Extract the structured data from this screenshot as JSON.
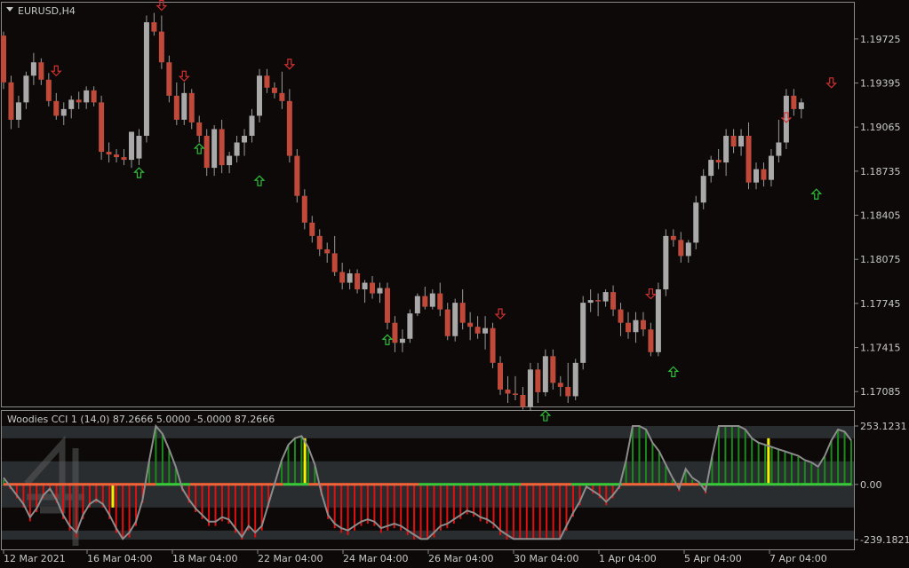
{
  "window": {
    "symbol_title": "EURUSD,H4",
    "indicator_title": "Woodies CCI 1 (14,0) 87.2666 5.0000 -5.0000 87.2666"
  },
  "colors": {
    "background": "#0c0908",
    "bull_candle": "#a9a9a9",
    "bear_candle": "#c0493a",
    "wick": "#9a9a9a",
    "up_arrow": "#2fbf3a",
    "down_arrow": "#d03030",
    "cci_line": "#8c8c8c",
    "hist_red": "#e01010",
    "hist_green": "#1a8a1a",
    "hist_yellow": "#f2f200",
    "zero_red": "#ff6030",
    "zero_green": "#30d030",
    "band": "#2a2d30",
    "axis_text": "#c8c8c8",
    "frame": "#8a8a8a"
  },
  "price_axis": {
    "labels": [
      "1.19725",
      "1.19395",
      "1.19065",
      "1.18735",
      "1.18405",
      "1.18075",
      "1.17745",
      "1.17415",
      "1.17085"
    ]
  },
  "indicator_axis": {
    "labels": [
      "253.1231",
      "0.00",
      "-239.1821"
    ]
  },
  "time_axis": {
    "labels": [
      "12 Mar 2021",
      "16 Mar 04:00",
      "18 Mar 04:00",
      "22 Mar 04:00",
      "24 Mar 04:00",
      "26 Mar 04:00",
      "30 Mar 04:00",
      "1 Apr 04:00",
      "5 Apr 04:00",
      "7 Apr 04:00"
    ]
  },
  "chart_data": [
    {
      "type": "candlestick",
      "title": "EURUSD,H4",
      "ylim": [
        1.1698,
        1.1999
      ],
      "ticks": [
        1.19725,
        1.19395,
        1.19065,
        1.18735,
        1.18405,
        1.18075,
        1.17745,
        1.17415,
        1.17085
      ],
      "bars": [
        [
          1.1975,
          1.1978,
          1.1935,
          1.194
        ],
        [
          1.194,
          1.1945,
          1.1905,
          1.1912
        ],
        [
          1.1912,
          1.193,
          1.1906,
          1.1925
        ],
        [
          1.1925,
          1.1948,
          1.192,
          1.1945
        ],
        [
          1.1945,
          1.1962,
          1.1938,
          1.1955
        ],
        [
          1.1955,
          1.1958,
          1.1938,
          1.1942
        ],
        [
          1.1942,
          1.1947,
          1.1922,
          1.1926
        ],
        [
          1.1926,
          1.1932,
          1.1912,
          1.1915
        ],
        [
          1.1915,
          1.1925,
          1.1908,
          1.192
        ],
        [
          1.192,
          1.193,
          1.1913,
          1.1927
        ],
        [
          1.1927,
          1.1933,
          1.192,
          1.1925
        ],
        [
          1.1925,
          1.1937,
          1.192,
          1.1934
        ],
        [
          1.1934,
          1.1937,
          1.1922,
          1.1925
        ],
        [
          1.1925,
          1.193,
          1.1882,
          1.1888
        ],
        [
          1.1888,
          1.1895,
          1.188,
          1.1886
        ],
        [
          1.1886,
          1.189,
          1.188,
          1.1884
        ],
        [
          1.1884,
          1.189,
          1.1878,
          1.1882
        ],
        [
          1.1882,
          1.1895,
          1.1876,
          1.1903
        ],
        [
          1.1883,
          1.1905,
          1.1878,
          1.19
        ],
        [
          1.19,
          1.199,
          1.1895,
          1.1985
        ],
        [
          1.1985,
          1.1992,
          1.1975,
          1.1978
        ],
        [
          1.1978,
          1.199,
          1.195,
          1.1955
        ],
        [
          1.1955,
          1.196,
          1.1925,
          1.193
        ],
        [
          1.193,
          1.194,
          1.1908,
          1.1912
        ],
        [
          1.1912,
          1.194,
          1.1908,
          1.1932
        ],
        [
          1.1932,
          1.1935,
          1.1905,
          1.191
        ],
        [
          1.191,
          1.1915,
          1.1895,
          1.19
        ],
        [
          1.19,
          1.1905,
          1.187,
          1.1876
        ],
        [
          1.1876,
          1.1908,
          1.187,
          1.1905
        ],
        [
          1.1905,
          1.1912,
          1.1872,
          1.1878
        ],
        [
          1.1878,
          1.1888,
          1.1872,
          1.1885
        ],
        [
          1.1885,
          1.19,
          1.188,
          1.1895
        ],
        [
          1.1895,
          1.1905,
          1.1885,
          1.19
        ],
        [
          1.19,
          1.192,
          1.1895,
          1.1915
        ],
        [
          1.1915,
          1.195,
          1.191,
          1.1945
        ],
        [
          1.1945,
          1.195,
          1.1932,
          1.1936
        ],
        [
          1.1936,
          1.194,
          1.1928,
          1.1932
        ],
        [
          1.1932,
          1.1948,
          1.192,
          1.1926
        ],
        [
          1.1926,
          1.1935,
          1.188,
          1.1885
        ],
        [
          1.1885,
          1.189,
          1.185,
          1.1855
        ],
        [
          1.1855,
          1.186,
          1.183,
          1.1835
        ],
        [
          1.1835,
          1.184,
          1.182,
          1.1825
        ],
        [
          1.1825,
          1.183,
          1.181,
          1.1815
        ],
        [
          1.1815,
          1.182,
          1.1805,
          1.1812
        ],
        [
          1.1812,
          1.1825,
          1.1795,
          1.1798
        ],
        [
          1.1798,
          1.1805,
          1.1785,
          1.179
        ],
        [
          1.179,
          1.18,
          1.1785,
          1.1797
        ],
        [
          1.1797,
          1.18,
          1.1782,
          1.1785
        ],
        [
          1.1785,
          1.1792,
          1.1775,
          1.179
        ],
        [
          1.179,
          1.1795,
          1.1778,
          1.1782
        ],
        [
          1.1782,
          1.179,
          1.1775,
          1.1786
        ],
        [
          1.1786,
          1.179,
          1.1755,
          1.176
        ],
        [
          1.176,
          1.1765,
          1.1738,
          1.1745
        ],
        [
          1.1745,
          1.1755,
          1.1738,
          1.1748
        ],
        [
          1.1748,
          1.177,
          1.1745,
          1.1767
        ],
        [
          1.1767,
          1.1782,
          1.1765,
          1.178
        ],
        [
          1.178,
          1.1787,
          1.177,
          1.1772
        ],
        [
          1.1772,
          1.1785,
          1.177,
          1.1782
        ],
        [
          1.1782,
          1.179,
          1.1765,
          1.177
        ],
        [
          1.177,
          1.1775,
          1.1747,
          1.175
        ],
        [
          1.175,
          1.1778,
          1.1746,
          1.1775
        ],
        [
          1.1775,
          1.1785,
          1.1755,
          1.176
        ],
        [
          1.176,
          1.1768,
          1.1747,
          1.1757
        ],
        [
          1.1757,
          1.1765,
          1.1748,
          1.1752
        ],
        [
          1.1752,
          1.1765,
          1.174,
          1.1756
        ],
        [
          1.1756,
          1.176,
          1.1726,
          1.173
        ],
        [
          1.173,
          1.1735,
          1.1706,
          1.171
        ],
        [
          1.171,
          1.172,
          1.17,
          1.1707
        ],
        [
          1.1707,
          1.172,
          1.1702,
          1.1706
        ],
        [
          1.1706,
          1.1712,
          1.1695,
          1.1697
        ],
        [
          1.1697,
          1.173,
          1.1694,
          1.1725
        ],
        [
          1.1725,
          1.173,
          1.17,
          1.1708
        ],
        [
          1.1708,
          1.174,
          1.1705,
          1.1735
        ],
        [
          1.1735,
          1.174,
          1.171,
          1.1715
        ],
        [
          1.1715,
          1.172,
          1.1705,
          1.1712
        ],
        [
          1.1712,
          1.173,
          1.17,
          1.1705
        ],
        [
          1.1705,
          1.1733,
          1.1702,
          1.173
        ],
        [
          1.173,
          1.178,
          1.1725,
          1.1775
        ],
        [
          1.1775,
          1.1785,
          1.1768,
          1.1777
        ],
        [
          1.1777,
          1.1782,
          1.1765,
          1.1776
        ],
        [
          1.1776,
          1.1785,
          1.1772,
          1.1783
        ],
        [
          1.1783,
          1.1788,
          1.1765,
          1.177
        ],
        [
          1.177,
          1.1775,
          1.175,
          1.176
        ],
        [
          1.176,
          1.1768,
          1.1748,
          1.1753
        ],
        [
          1.1753,
          1.1768,
          1.1745,
          1.1762
        ],
        [
          1.1762,
          1.1768,
          1.175,
          1.1755
        ],
        [
          1.1755,
          1.176,
          1.1735,
          1.1738
        ],
        [
          1.1738,
          1.179,
          1.1735,
          1.1785
        ],
        [
          1.1785,
          1.183,
          1.178,
          1.1825
        ],
        [
          1.1825,
          1.183,
          1.1817,
          1.1822
        ],
        [
          1.1822,
          1.1828,
          1.1805,
          1.181
        ],
        [
          1.181,
          1.1822,
          1.1805,
          1.182
        ],
        [
          1.182,
          1.1855,
          1.1815,
          1.185
        ],
        [
          1.185,
          1.1875,
          1.1845,
          1.187
        ],
        [
          1.187,
          1.1885,
          1.1865,
          1.1882
        ],
        [
          1.1882,
          1.189,
          1.1875,
          1.188
        ],
        [
          1.188,
          1.1905,
          1.187,
          1.19
        ],
        [
          1.19,
          1.1905,
          1.1887,
          1.1892
        ],
        [
          1.1892,
          1.1905,
          1.1885,
          1.19
        ],
        [
          1.19,
          1.191,
          1.186,
          1.1865
        ],
        [
          1.1865,
          1.188,
          1.186,
          1.1875
        ],
        [
          1.1875,
          1.188,
          1.1862,
          1.1867
        ],
        [
          1.1867,
          1.189,
          1.1862,
          1.1885
        ],
        [
          1.1885,
          1.1912,
          1.188,
          1.1895
        ],
        [
          1.1895,
          1.1935,
          1.189,
          1.193
        ],
        [
          1.193,
          1.1935,
          1.1915,
          1.192
        ],
        [
          1.192,
          1.1928,
          1.1913,
          1.1925
        ]
      ],
      "signals": [
        {
          "bar": 7,
          "dir": "down",
          "price": 1.1949
        },
        {
          "bar": 18,
          "dir": "up",
          "price": 1.1872
        },
        {
          "bar": 21,
          "dir": "down",
          "price": 1.1998
        },
        {
          "bar": 24,
          "dir": "down",
          "price": 1.1945
        },
        {
          "bar": 26,
          "dir": "up",
          "price": 1.189
        },
        {
          "bar": 34,
          "dir": "up",
          "price": 1.1866
        },
        {
          "bar": 38,
          "dir": "down",
          "price": 1.1954
        },
        {
          "bar": 51,
          "dir": "up",
          "price": 1.1747
        },
        {
          "bar": 66,
          "dir": "down",
          "price": 1.1767
        },
        {
          "bar": 72,
          "dir": "up",
          "price": 1.169
        },
        {
          "bar": 86,
          "dir": "down",
          "price": 1.1782
        },
        {
          "bar": 89,
          "dir": "up",
          "price": 1.1723
        },
        {
          "bar": 104,
          "dir": "down",
          "price": 1.1914
        },
        {
          "bar": 108,
          "dir": "up",
          "price": 1.1856
        },
        {
          "bar": 110,
          "dir": "down",
          "price": 1.194
        }
      ]
    },
    {
      "type": "histogram+line",
      "title": "Woodies CCI 1 (14,0) 87.2666 5.0000 -5.0000 87.2666",
      "ylim": [
        -239.1821,
        253.1231
      ],
      "levels": [
        100,
        0,
        -100,
        -200
      ],
      "cci": [
        20,
        -20,
        -60,
        -100,
        -160,
        -120,
        -60,
        -30,
        -80,
        -150,
        -200,
        -230,
        -150,
        -100,
        -80,
        -100,
        -150,
        -210,
        -260,
        -230,
        -180,
        -80,
        100,
        260,
        220,
        150,
        70,
        -30,
        -80,
        -120,
        -150,
        -180,
        -180,
        -160,
        -170,
        -210,
        -250,
        -200,
        -230,
        -200,
        -100,
        0,
        100,
        170,
        200,
        210,
        160,
        80,
        -50,
        -150,
        -190,
        -210,
        -220,
        -200,
        -180,
        -170,
        -180,
        -210,
        -200,
        -190,
        -200,
        -220,
        -240,
        -280,
        -260,
        -230,
        -200,
        -190,
        -170,
        -150,
        -130,
        -140,
        -160,
        -170,
        -190,
        -220,
        -240,
        -260,
        -290,
        -310,
        -330,
        -340,
        -320,
        -300,
        -260,
        -200,
        -140,
        -90,
        -20,
        -40,
        -60,
        -90,
        -60,
        -20,
        100,
        300,
        290,
        240,
        180,
        140,
        80,
        20,
        -30,
        60,
        20,
        0,
        -40,
        120,
        400,
        380,
        330,
        280,
        240,
        200,
        180,
        170,
        160,
        150,
        140,
        130,
        120,
        100,
        90,
        70,
        120,
        190,
        240,
        230,
        190
      ]
    }
  ]
}
